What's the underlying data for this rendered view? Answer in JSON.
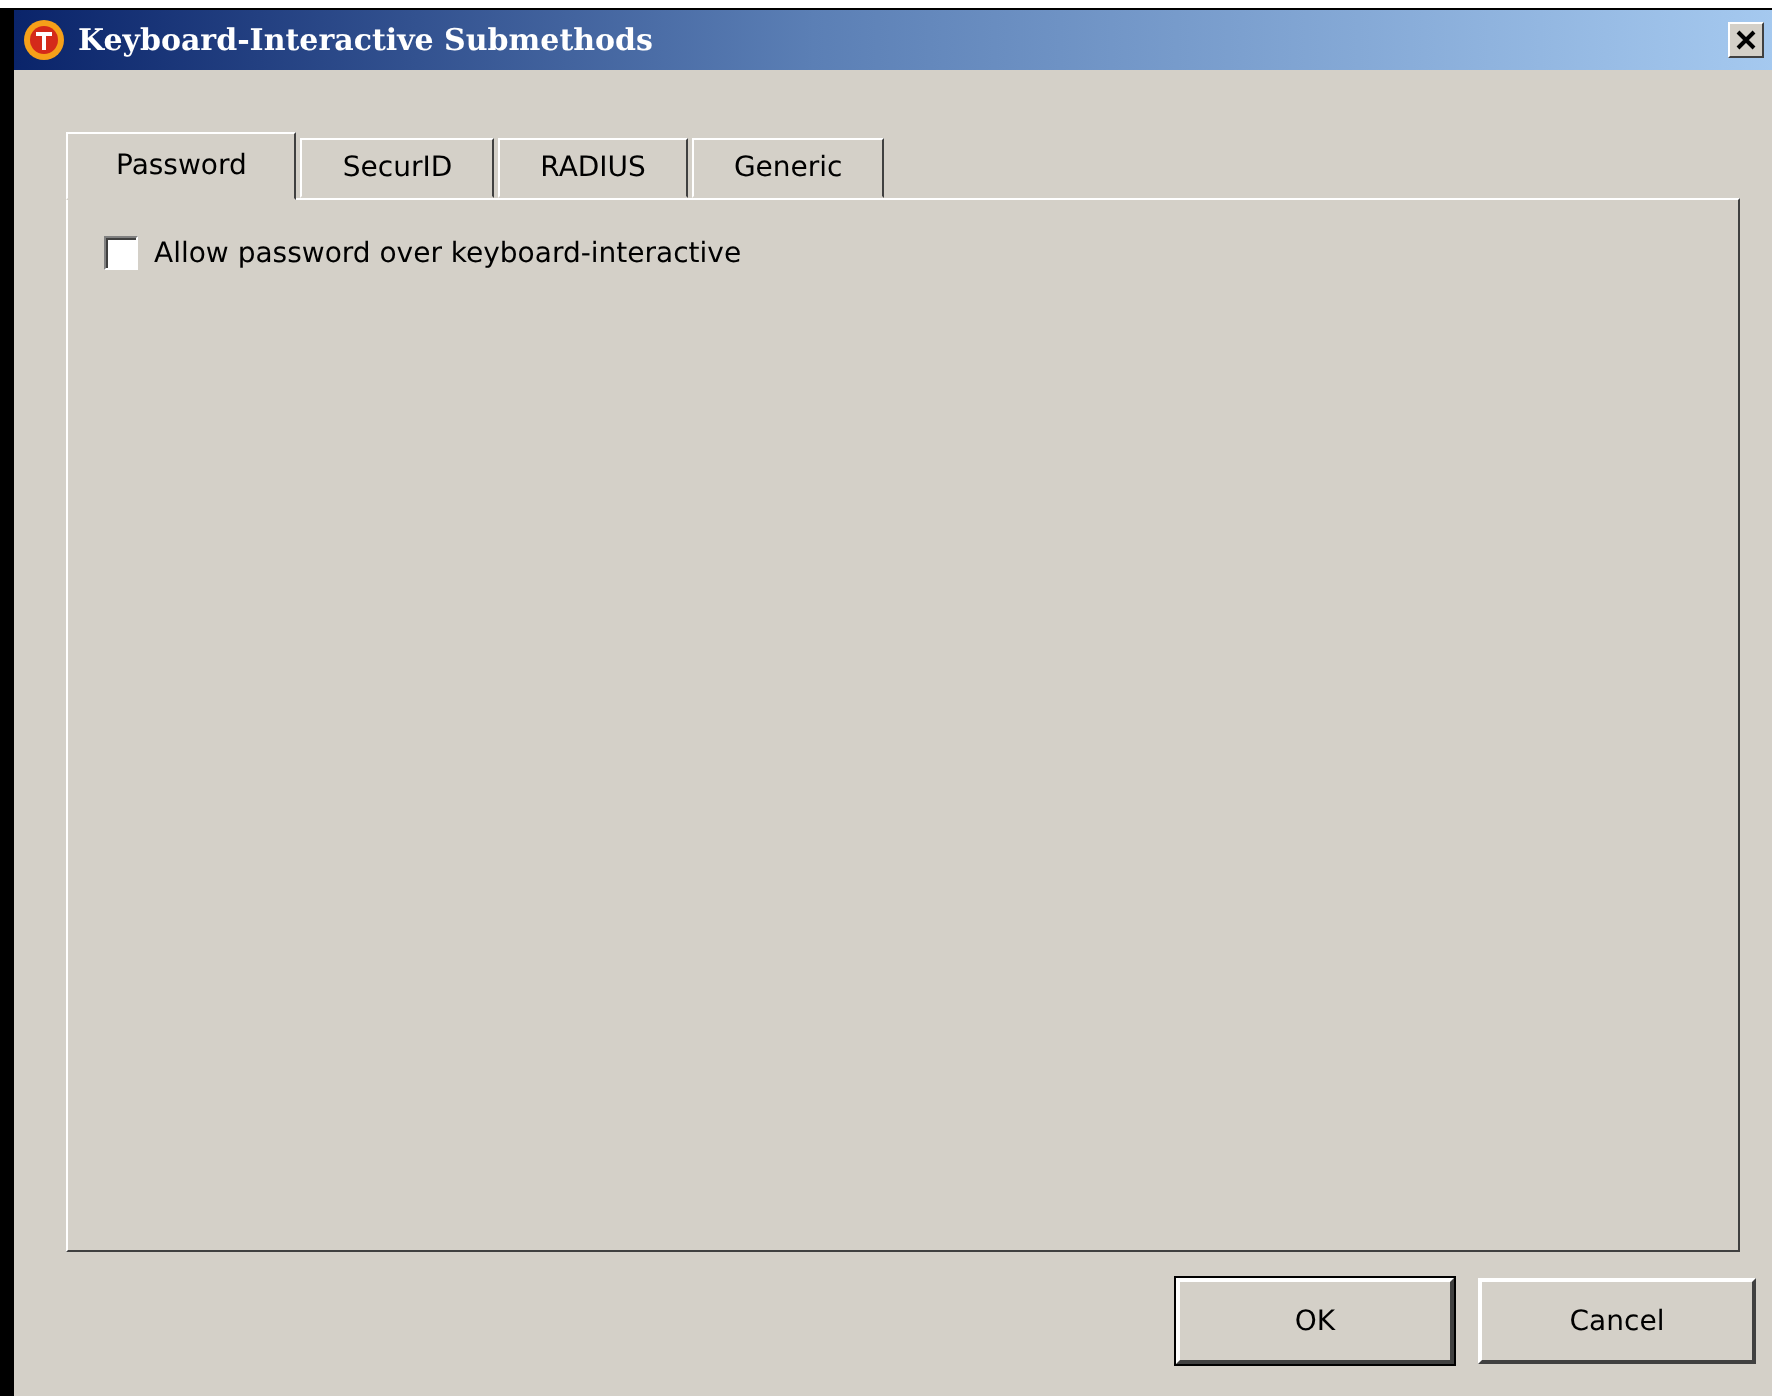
{
  "window": {
    "title": "Keyboard-Interactive Submethods"
  },
  "tabs": [
    {
      "label": "Password",
      "selected": true
    },
    {
      "label": "SecurID",
      "selected": false
    },
    {
      "label": "RADIUS",
      "selected": false
    },
    {
      "label": "Generic",
      "selected": false
    }
  ],
  "options": [
    {
      "label": "Allow password over keyboard-interactive",
      "checked": false
    }
  ],
  "buttons": [
    {
      "label": "OK",
      "default": true
    },
    {
      "label": "Cancel",
      "default": false
    }
  ]
}
